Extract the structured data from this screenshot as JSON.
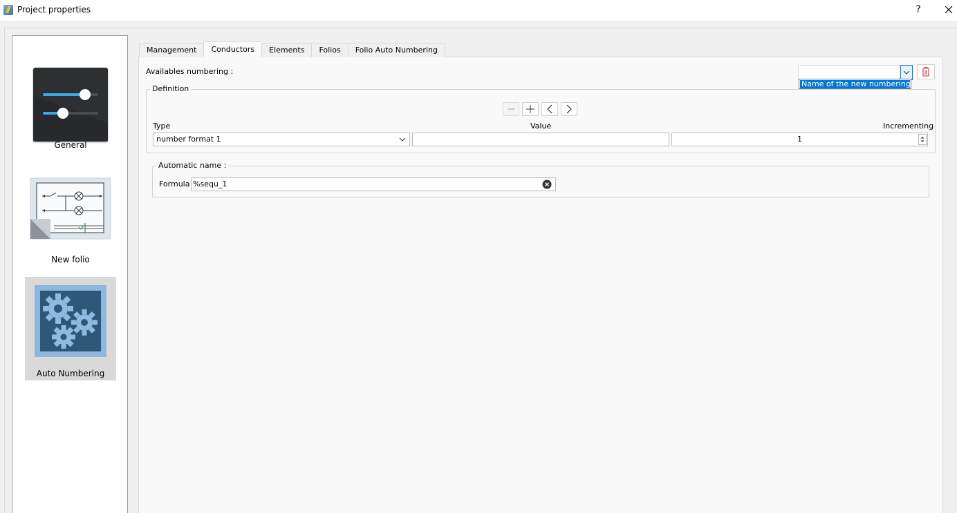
{
  "window": {
    "title": "Project properties",
    "help_label": "?"
  },
  "sidebar": {
    "items": [
      {
        "label": "General",
        "icon": "sliders-icon",
        "selected": false
      },
      {
        "label": "New folio",
        "icon": "folio-schematic-icon",
        "selected": false
      },
      {
        "label": "Auto Numbering",
        "icon": "gears-icon",
        "selected": true
      }
    ]
  },
  "tabs": [
    {
      "label": "Management",
      "active": false
    },
    {
      "label": "Conductors",
      "active": true
    },
    {
      "label": "Elements",
      "active": false
    },
    {
      "label": "Folios",
      "active": false
    },
    {
      "label": "Folio Auto Numbering",
      "active": false
    }
  ],
  "numbering": {
    "available_label": "Availables numbering :",
    "combo_value": "",
    "dropdown_option": "Name of the new numbering"
  },
  "definition": {
    "title": "Definition",
    "col_type": "Type",
    "col_value": "Value",
    "col_increment": "Incrementing",
    "type_value": "number format 1",
    "value_value": "",
    "increment_value": "1"
  },
  "automatic_name": {
    "title": "Automatic name :",
    "formula_label": "Formula",
    "formula_value": "%sequ_1"
  },
  "colors": {
    "accent": "#0078d7",
    "selected_item_bg": "#d9d9d9",
    "gear_panel": "#2e5778",
    "delete_icon": "#c43b3b"
  }
}
